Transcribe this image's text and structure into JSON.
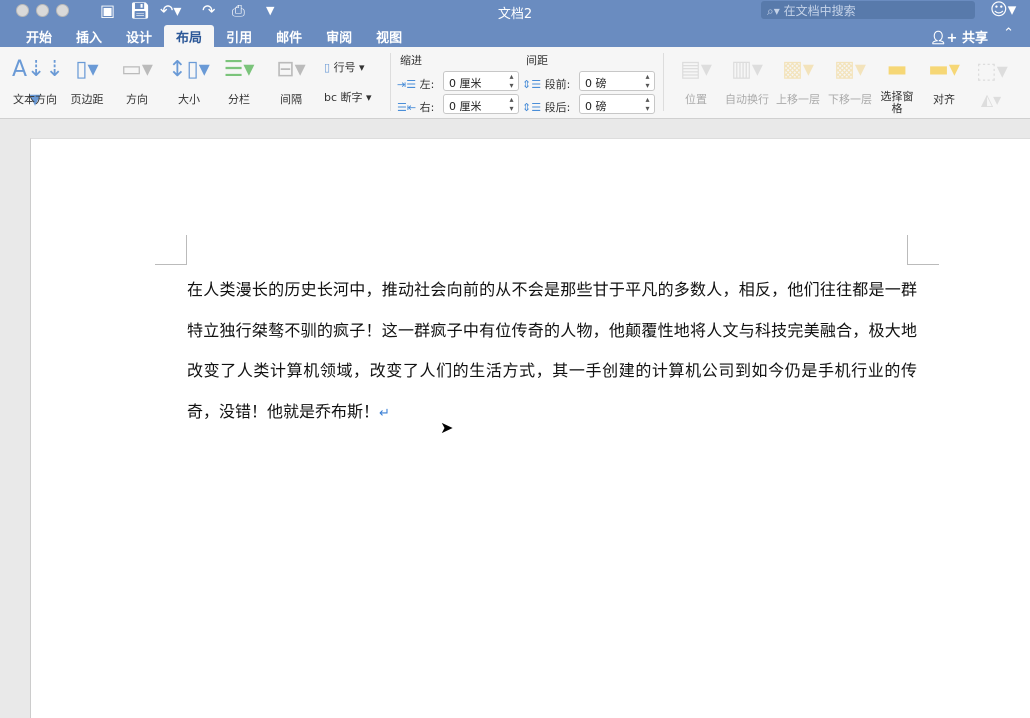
{
  "window": {
    "title": "文档2"
  },
  "search": {
    "placeholder": "在文档中搜索"
  },
  "tabs": [
    "开始",
    "插入",
    "设计",
    "布局",
    "引用",
    "邮件",
    "审阅",
    "视图"
  ],
  "active_tab": "布局",
  "share_label": "共享",
  "ribbon": {
    "page_setup": [
      {
        "label": "文本方向",
        "icon": "text-direction-icon"
      },
      {
        "label": "页边距",
        "icon": "margins-icon"
      },
      {
        "label": "方向",
        "icon": "orientation-icon"
      },
      {
        "label": "大小",
        "icon": "size-icon"
      },
      {
        "label": "分栏",
        "icon": "columns-icon"
      },
      {
        "label": "间隔",
        "icon": "breaks-icon"
      }
    ],
    "line_numbers": "行号",
    "hyphenation": "断字",
    "indent": {
      "heading": "缩进",
      "left_label": "左:",
      "left_value": "0 厘米",
      "right_label": "右:",
      "right_value": "0 厘米"
    },
    "spacing": {
      "heading": "间距",
      "before_label": "段前:",
      "before_value": "0 磅",
      "after_label": "段后:",
      "after_value": "0 磅"
    },
    "arrange": [
      {
        "label": "位置",
        "enabled": false
      },
      {
        "label": "自动换行",
        "enabled": false
      },
      {
        "label": "上移一层",
        "enabled": false
      },
      {
        "label": "下移一层",
        "enabled": false
      },
      {
        "label": "选择窗格",
        "enabled": true
      },
      {
        "label": "对齐",
        "enabled": true
      }
    ]
  },
  "document": {
    "text": "在人类漫长的历史长河中，推动社会向前的从不会是那些甘于平凡的多数人，相反，他们往往都是一群特立独行桀骜不驯的疯子！这一群疯子中有位传奇的人物，他颠覆性地将人文与科技完美融合，极大地改变了人类计算机领域，改变了人们的生活方式，其一手创建的计算机公司到如今仍是手机行业的传奇，没错！他就是乔布斯！",
    "paragraph_mark": "↵"
  }
}
